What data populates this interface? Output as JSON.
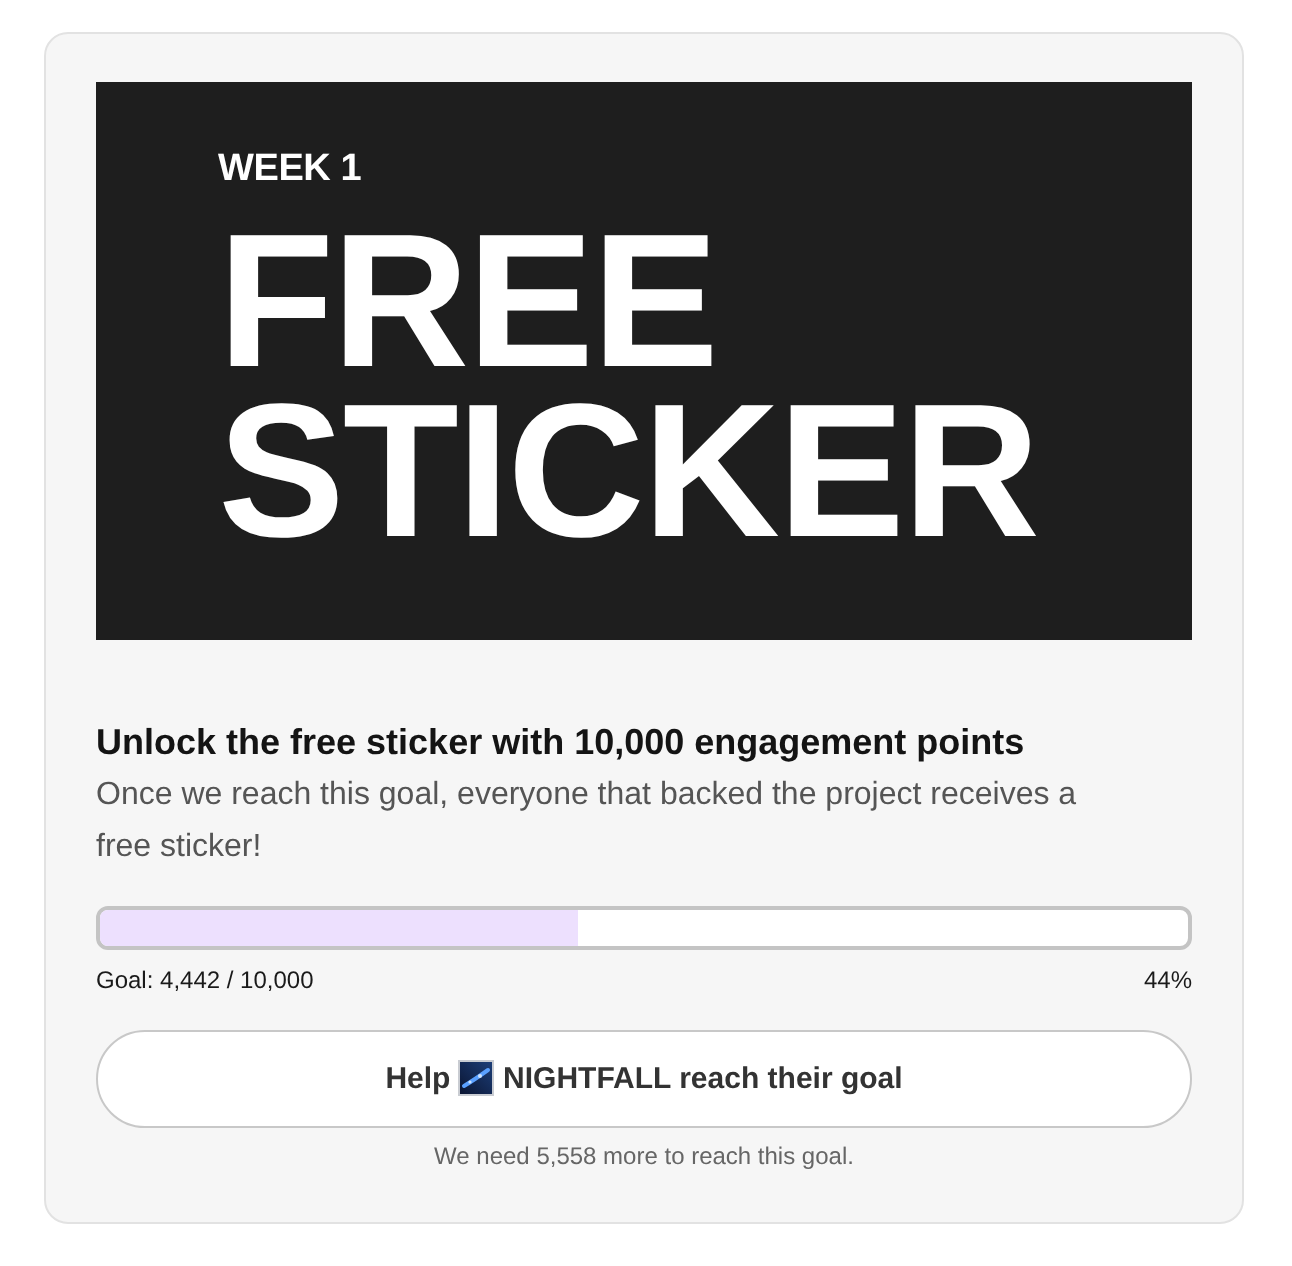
{
  "banner": {
    "eyebrow": "WEEK 1",
    "headline": "FREE STICKER"
  },
  "goal": {
    "title": "Unlock the free sticker with 10,000 engagement points",
    "description": "Once we reach this goal, everyone that backed the project receives a free sticker!"
  },
  "progress": {
    "level": 0.44,
    "count": "Goal: 4,442 / 10,000",
    "percent": "44%"
  },
  "button": {
    "label_start": "Help",
    "label_end": "NIGHTFALL reach their goal"
  },
  "footnote": "We need 5,558 more to reach this goal."
}
